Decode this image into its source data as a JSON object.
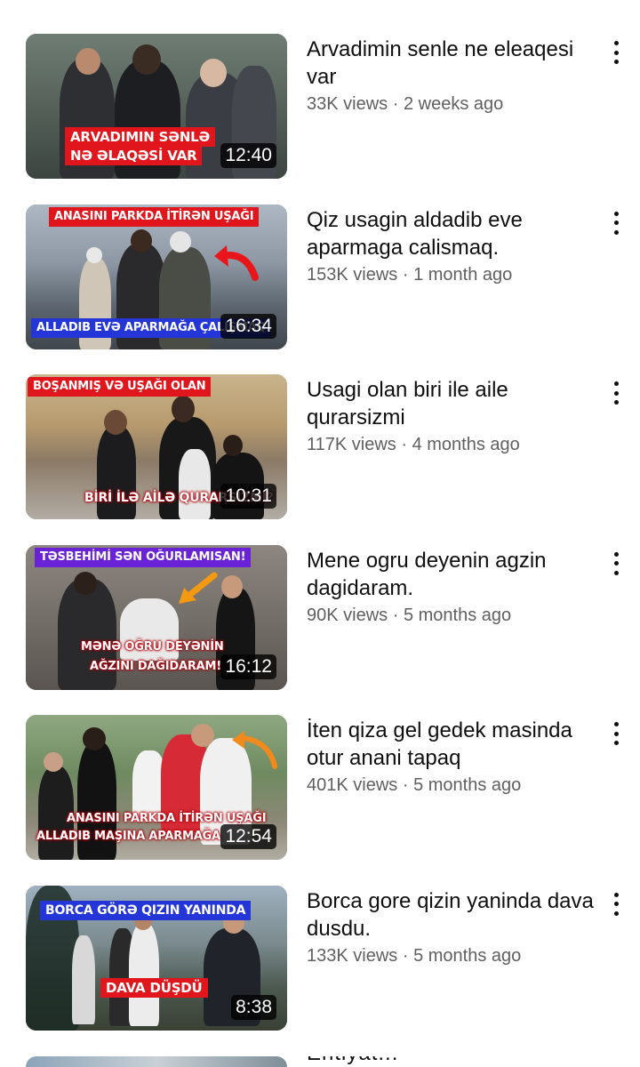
{
  "videos": [
    {
      "title": "Arvadimin senle ne eleaqesi var",
      "views": "33K views",
      "age": "2 weeks ago",
      "duration": "12:40",
      "thumb_text": [
        "ARVADIMIN SƏNLƏ",
        "NƏ ƏLAQƏSİ VAR"
      ]
    },
    {
      "title": "Qiz usagin aldadib eve aparmaga calismaq.",
      "views": "153K views",
      "age": "1 month ago",
      "duration": "16:34",
      "thumb_text": [
        "ANASINI PARKDA İTİRƏN UŞAĞI",
        "ALLADIB EVƏ APARMAĞA ÇALIŞMAQ"
      ]
    },
    {
      "title": "Usagi olan biri ile aile qurarsizmi",
      "views": "117K views",
      "age": "4 months ago",
      "duration": "10:31",
      "thumb_text": [
        "BOŞANMIŞ VƏ UŞAĞI OLAN",
        "BİRİ İLƏ AİLƏ QURARSIZMI?"
      ]
    },
    {
      "title": "Mene ogru deyenin agzin dagidaram.",
      "views": "90K views",
      "age": "5 months ago",
      "duration": "16:12",
      "thumb_text": [
        "TƏSBEHİMİ SƏN OĞURLAMISAN!",
        "MƏNƏ OĞRU DEYƏNİN",
        "AĞZINI DAĞIDARAM!"
      ]
    },
    {
      "title": "İten qiza gel gedek masinda otur anani tapaq",
      "views": "401K views",
      "age": "5 months ago",
      "duration": "12:54",
      "thumb_text": [
        "ANASINI PARKDA İTİRƏN UŞAĞI",
        "ALLADIB MAŞINA APARMAĞA"
      ]
    },
    {
      "title": "Borca gore qizin yaninda dava dusdu.",
      "views": "133K views",
      "age": "5 months ago",
      "duration": "8:38",
      "thumb_text": [
        "BORCA GÖRƏ QIZIN YANINDA",
        "DAVA DÜŞDÜ"
      ]
    }
  ],
  "separator": "·",
  "partial_next_title": "Ehtiyat..."
}
